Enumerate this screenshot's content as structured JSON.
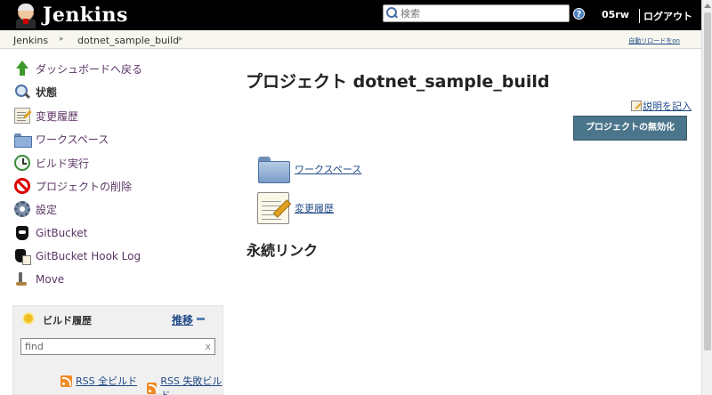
{
  "header": {
    "logo_text": "Jenkins",
    "search_placeholder": "検索",
    "help": "?",
    "user": "05rw",
    "logout": "ログアウト"
  },
  "breadcrumb": {
    "items": [
      "Jenkins",
      "dotnet_sample_build"
    ],
    "separator": "▸",
    "auto_refresh": "自動リロードをon"
  },
  "sidebar": {
    "tasks": [
      {
        "label": "ダッシュボードへ戻る",
        "icon": "up-arrow-icon"
      },
      {
        "label": "状態",
        "icon": "search-icon"
      },
      {
        "label": "変更履歴",
        "icon": "notepad-icon"
      },
      {
        "label": "ワークスペース",
        "icon": "folder-icon"
      },
      {
        "label": "ビルド実行",
        "icon": "clock-icon"
      },
      {
        "label": "プロジェクトの削除",
        "icon": "no-entry-icon"
      },
      {
        "label": "設定",
        "icon": "gear-icon"
      },
      {
        "label": "GitBucket",
        "icon": "gitbucket-icon"
      },
      {
        "label": "GitBucket Hook Log",
        "icon": "gitbucket-log-icon"
      },
      {
        "label": "Move",
        "icon": "move-icon"
      }
    ]
  },
  "build_history": {
    "title": "ビルド履歴",
    "trend": "推移",
    "filter_value": "find",
    "clear": "x",
    "rss_all": "RSS 全ビルド",
    "rss_failed": "RSS 失敗ビルド"
  },
  "main": {
    "title": "プロジェクト dotnet_sample_build",
    "edit_description": "説明を記入",
    "disable_button": "プロジェクトの無効化",
    "links": [
      {
        "label": "ワークスペース",
        "icon": "folder-icon"
      },
      {
        "label": "変更履歴",
        "icon": "notepad-icon"
      }
    ],
    "permalinks_heading": "永続リンク"
  },
  "colors": {
    "header_bg": "#000000",
    "link": "#204a87",
    "task_link": "#5c3566",
    "button_bg": "#4b758b"
  }
}
